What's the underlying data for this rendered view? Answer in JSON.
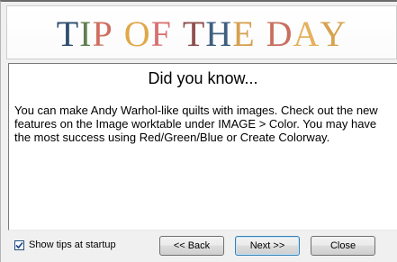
{
  "window": {
    "title_parts": [
      "T",
      "I",
      "P",
      " ",
      "O",
      "F",
      " ",
      "T",
      "H",
      "E",
      " ",
      "D",
      "A",
      "Y"
    ],
    "title_colors": [
      "#2f4f6f",
      "#5f7f4f",
      "#cf6f5f",
      "#ffffff",
      "#e0a84a",
      "#d86f6f",
      "#ffffff",
      "#8f4f4f",
      "#3f5f7f",
      "#d5a04f",
      "#ffffff",
      "#c86f5f",
      "#e6b15f",
      "#d6a24f"
    ]
  },
  "tip": {
    "heading": "Did you know...",
    "body": "You can make Andy Warhol-like quilts with images. Check out the new features on the Image worktable under IMAGE > Color. You may have the most success using Red/Green/Blue or Create Colorway."
  },
  "footer": {
    "show_tips_label": "Show tips at startup",
    "show_tips_checked": true,
    "back_label": "<< Back",
    "next_label": "Next >>",
    "close_label": "Close"
  }
}
